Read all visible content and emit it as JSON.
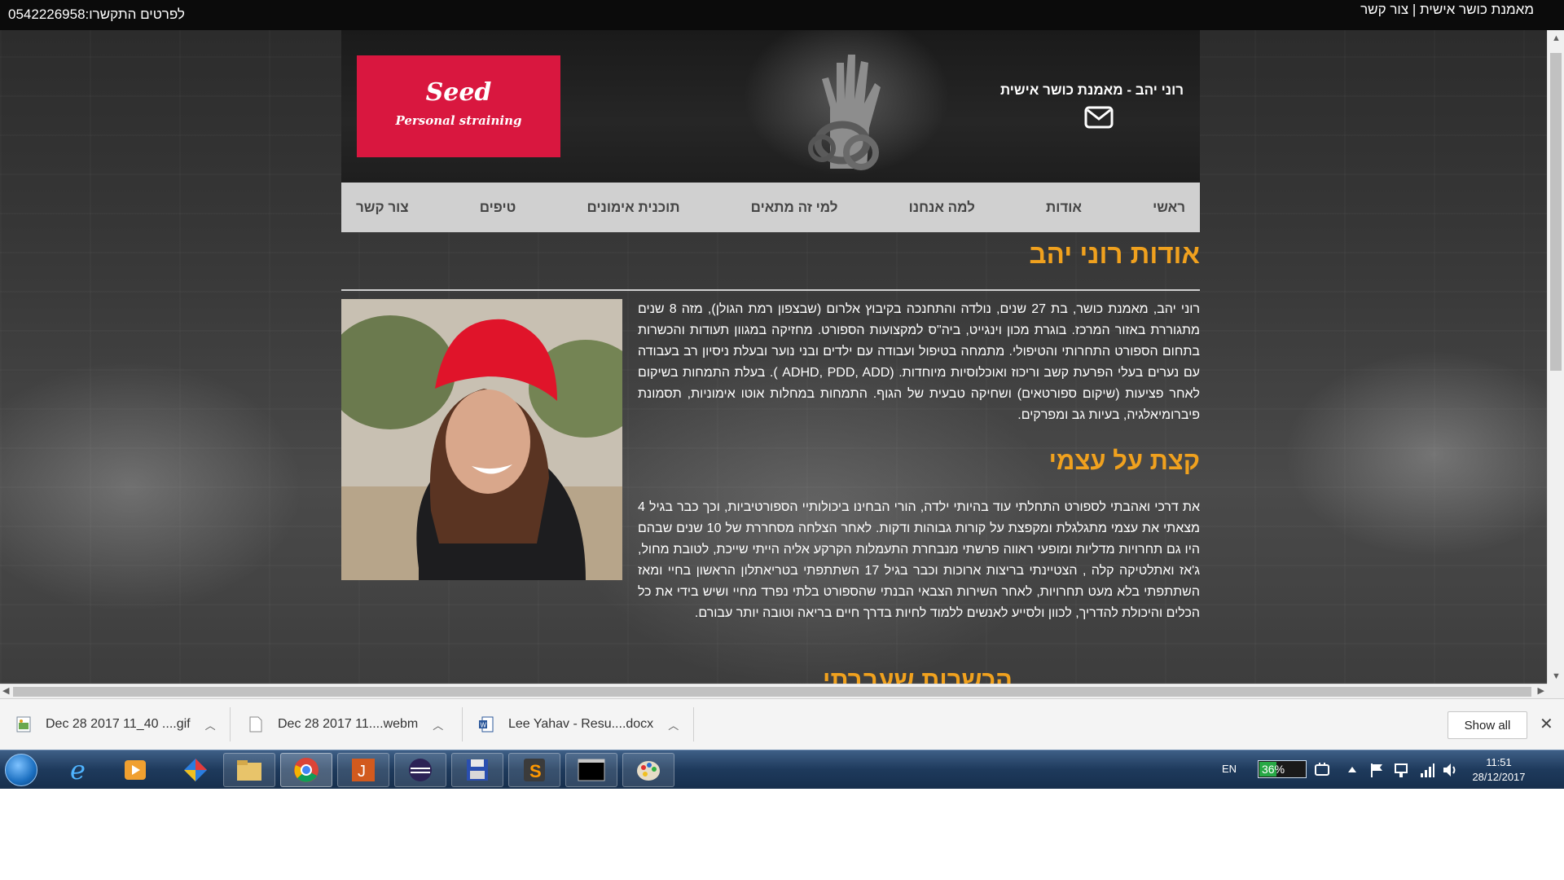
{
  "topbar": {
    "phone": "לפרטים התקשרו:0542226958",
    "title_link": "מאמנת כושר אישית",
    "separator": "|",
    "contact_link": "צור קשר"
  },
  "header": {
    "logo_title": "Seed",
    "logo_subtitle": "Personal straining",
    "site_title": "רוני יהב - מאמנת כושר אישית"
  },
  "nav": {
    "items": [
      "ראשי",
      "אודות",
      "למה אנחנו",
      "למי זה מתאים",
      "תוכנית אימונים",
      "טיפים",
      "צור קשר"
    ]
  },
  "content": {
    "section_title": "אודות רוני יהב",
    "paragraph1": "רוני יהב, מאמנת כושר, בת 27 שנים, נולדה והתחנכה בקיבוץ אלרום (שבצפון רמת הגולן), מזה 8 שנים מתגוררת באזור המרכז. בוגרת מכון וינגייט, ביה\"ס למקצועות הספורט. מחזיקה במגוון תעודות והכשרות בתחום הספורט התחרותי והטיפולי. מתמחה בטיפול ועבודה עם ילדים ובני נוער ובעלת ניסיון רב בעבודה עם נערים בעלי הפרעת קשב וריכוז ואוכלוסיות מיוחדות. (ADHD, PDD, ADD ). בעלת התמחות בשיקום לאחר פציעות (שיקום ספורטאים) ושחיקה טבעית של הגוף. התמחות במחלות אוטו אימוניות, תסמונת פיברומיאלגיה, בעיות גב ומפרקים.",
    "subsection_title": "קצת על עצמי",
    "paragraph2": "את דרכי ואהבתי לספורט התחלתי עוד בהיותי ילדה, הורי הבחינו ביכולותיי הספורטיביות, וכך כבר בגיל 4 מצאתי את עצמי מתגלגלת ומקפצת על קורות גבוהות ודקות. לאחר הצלחה מסחררת של 10 שנים שבהם היו גם תחרויות מדליות ומופעי ראווה פרשתי מנבחרת התעמלות הקרקע אליה הייתי שייכת, לטובת מחול, ג'אז ואתלטיקה קלה , הצטיינתי בריצות ארוכות וכבר בגיל 17 השתתפתי בטריאתלון הראשון בחיי ומאז השתתפתי בלא מעט תחרויות, לאחר השירות הצבאי הבנתי שהספורט בלתי נפרד מחיי ושיש בידי את כל הכלים והיכולת להדריך, לכוון ולסייע לאנשים ללמוד לחיות בדרך חיים בריאה וטובה יותר עבורם.",
    "next_title": "הכשרות שעברתי"
  },
  "downloads": {
    "items": [
      {
        "name": "Dec 28 2017 11_40 ....gif",
        "icon": "image-file-icon"
      },
      {
        "name": "Dec 28 2017 11....webm",
        "icon": "blank-file-icon"
      },
      {
        "name": "Lee Yahav - Resu....docx",
        "icon": "word-file-icon"
      }
    ],
    "show_all": "Show all",
    "close": "✕"
  },
  "taskbar": {
    "language": "EN",
    "battery_percent": 36,
    "battery_label": "36%",
    "time": "11:51",
    "date": "28/12/2017"
  },
  "colors": {
    "accent_orange": "#f0a11e",
    "logo_red": "#d9173f",
    "nav_bg": "#d0d0d0"
  }
}
